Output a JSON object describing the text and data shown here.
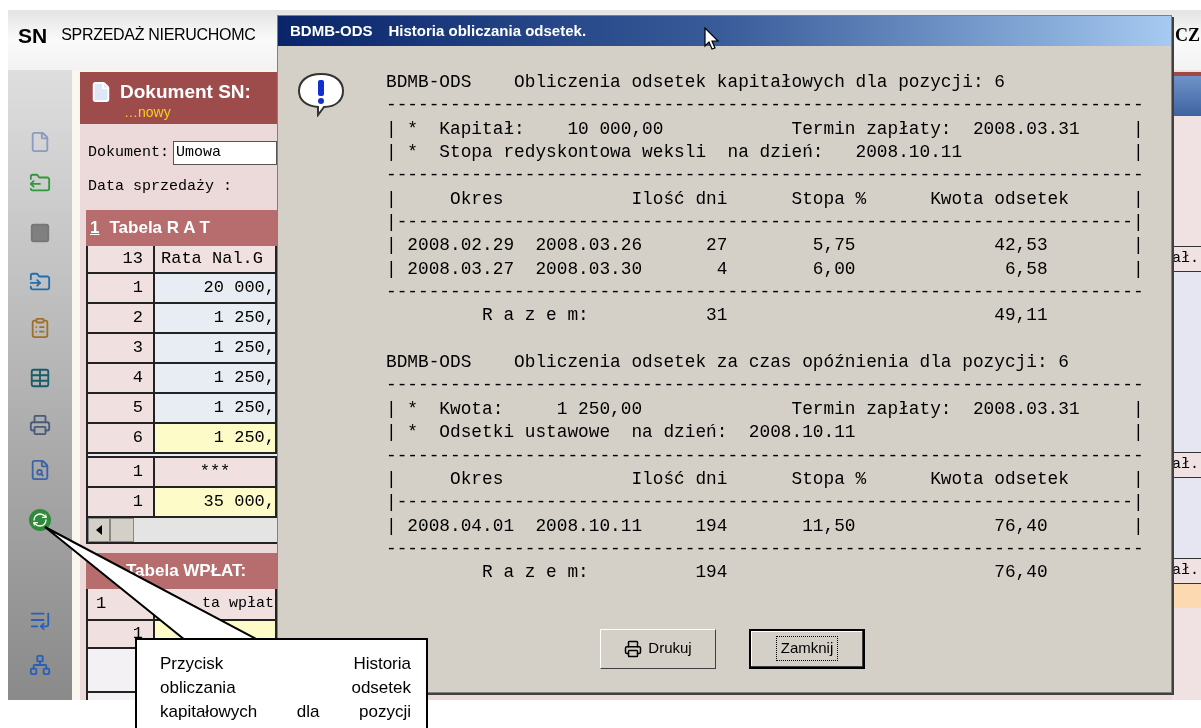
{
  "app": {
    "logo": "SN",
    "title": "SPRZEDAŻ NIERUCHOMC",
    "title_right": "CZ"
  },
  "document": {
    "title": "Dokument SN:",
    "status": "…nowy",
    "fields": [
      {
        "label": "Dokument:",
        "value": "Umowa"
      },
      {
        "label": "Data sprzedaży :"
      }
    ]
  },
  "installments": {
    "number": "1",
    "title": "Tabela R A T",
    "columns": [
      "13",
      "Rata Nal.G"
    ],
    "rows": [
      {
        "no": "1",
        "value": "20 000,",
        "selected": false
      },
      {
        "no": "2",
        "value": "1 250,",
        "selected": false
      },
      {
        "no": "3",
        "value": "1 250,",
        "selected": false
      },
      {
        "no": "4",
        "value": "1 250,",
        "selected": false
      },
      {
        "no": "5",
        "value": "1 250,",
        "selected": false
      },
      {
        "no": "6",
        "value": "1 250,",
        "selected": true
      }
    ],
    "summary_rows": [
      {
        "no": "1",
        "value": "***",
        "selected": false
      },
      {
        "no": "1",
        "value": "35 000,",
        "selected": true
      }
    ]
  },
  "payments": {
    "title": "Tabela WPŁAT:",
    "columns": [
      "1",
      "ta wpłat"
    ],
    "rows": [
      {
        "no": "1",
        "selected": true
      }
    ]
  },
  "right_panel": {
    "headers": [
      "ał.",
      "ał.",
      "ał."
    ]
  },
  "dialog": {
    "code": "BDMB-ODS",
    "title": "Historia obliczania odsetek.",
    "report": {
      "sections": [
        {
          "lines": [
            "BDMB-ODS    Obliczenia odsetek kapitałowych dla pozycji: 6",
            "-----------------------------------------------------------------------",
            "| *  Kapitał:    10 000,00            Termin zapłaty:  2008.03.31     |",
            "| *  Stopa redyskontowa weksli  na dzień:   2008.10.11                |",
            "-----------------------------------------------------------------------",
            "|     Okres            Ilość dni      Stopa %      Kwota odsetek      |",
            "|---------------------------------------------------------------------|",
            "| 2008.02.29  2008.03.26      27        5,75             42,53        |",
            "| 2008.03.27  2008.03.30       4        6,00              6,58        |",
            "-----------------------------------------------------------------------",
            "         R a z e m:           31                         49,11"
          ]
        },
        {
          "lines": [
            "BDMB-ODS    Obliczenia odsetek za czas opóźnienia dla pozycji: 6",
            "-----------------------------------------------------------------------",
            "| *  Kwota:     1 250,00              Termin zapłaty:  2008.03.31     |",
            "| *  Odsetki ustawowe  na dzień:  2008.10.11                          |",
            "-----------------------------------------------------------------------",
            "|     Okres            Ilość dni      Stopa %      Kwota odsetek      |",
            "|---------------------------------------------------------------------|",
            "| 2008.04.01  2008.10.11     194       11,50             76,40        |",
            "-----------------------------------------------------------------------",
            "         R a z e m:          194                         76,40"
          ]
        }
      ]
    },
    "buttons": [
      {
        "kind": "print",
        "label": "Drukuj",
        "focused": false
      },
      {
        "kind": "close",
        "label": "Zamknij",
        "focused": true
      }
    ]
  },
  "callout": {
    "lines": [
      "Przycisk Historia",
      "obliczania odsetek",
      "kapitałowych dla pozycji"
    ]
  }
}
